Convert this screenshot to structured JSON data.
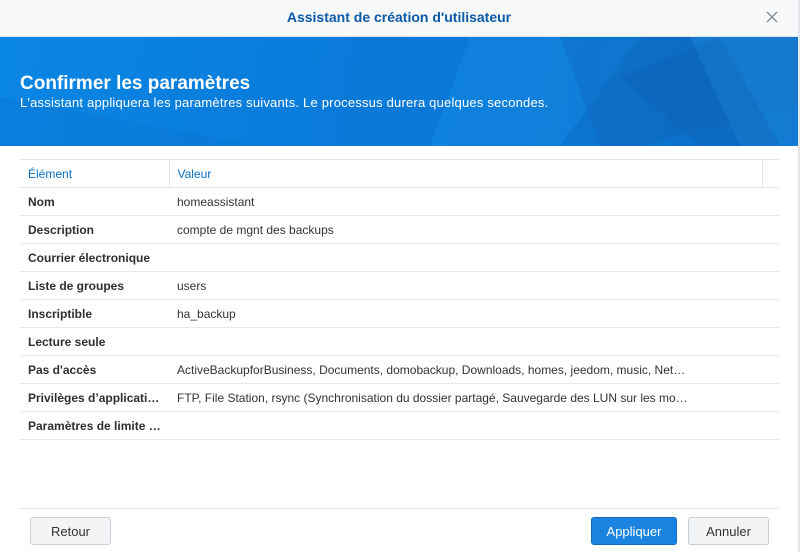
{
  "window": {
    "title": "Assistant de création d'utilisateur"
  },
  "banner": {
    "heading": "Confirmer les paramètres",
    "subtitle": "L'assistant appliquera les paramètres suivants. Le processus durera quelques secondes."
  },
  "table": {
    "columns": [
      "Élément",
      "Valeur"
    ],
    "rows": [
      {
        "key": "Nom",
        "value": "homeassistant"
      },
      {
        "key": "Description",
        "value": "compte de mgnt des backups"
      },
      {
        "key": "Courrier électronique",
        "value": ""
      },
      {
        "key": "Liste de groupes",
        "value": "users"
      },
      {
        "key": "Inscriptible",
        "value": "ha_backup"
      },
      {
        "key": "Lecture seule",
        "value": ""
      },
      {
        "key": "Pas d'accès",
        "value": "ActiveBackupforBusiness, Documents, domobackup, Downloads, homes, jeedom, music, Net…"
      },
      {
        "key": "Privilèges d’applications",
        "value": "FTP, File Station, rsync (Synchronisation du dossier partagé, Sauvegarde des LUN sur les mo…"
      },
      {
        "key": "Paramètres de limite de vitesse",
        "value": ""
      }
    ]
  },
  "footer": {
    "back_label": "Retour",
    "apply_label": "Appliquer",
    "cancel_label": "Annuler"
  },
  "colors": {
    "accent": "#0a7ad9",
    "title_text": "#0a5aa6",
    "primary_button": "#1a84e0"
  }
}
